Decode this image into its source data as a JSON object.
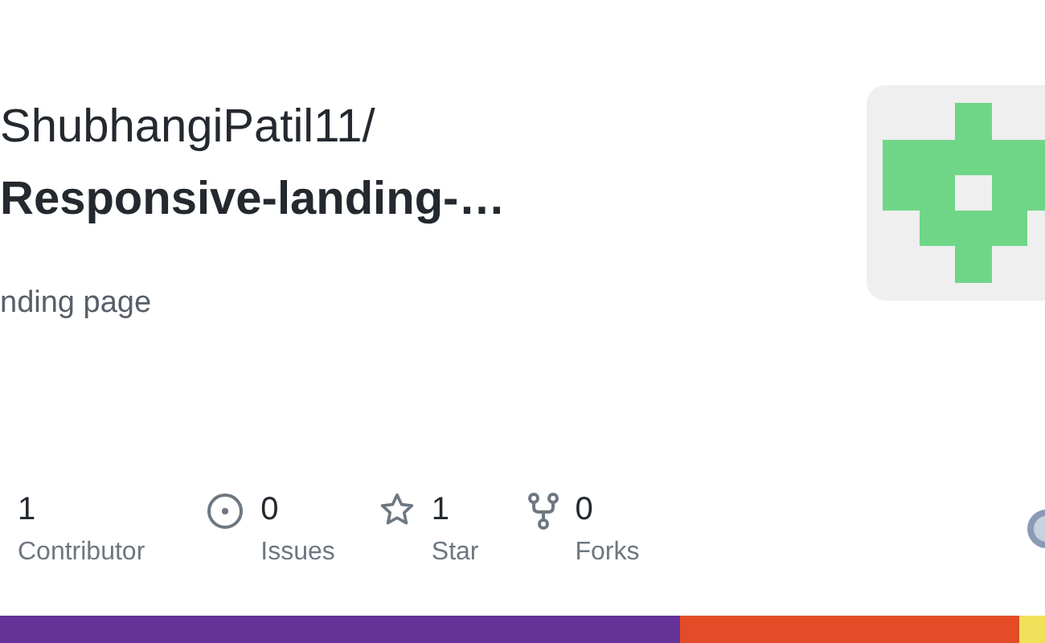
{
  "repo": {
    "owner": "ShubhangiPatil11/",
    "name": "Responsive-landing-…",
    "description": "nding page"
  },
  "stats": [
    {
      "kind": "plain",
      "count": "1",
      "label": "Contributor"
    },
    {
      "kind": "issues",
      "count": "0",
      "label": "Issues"
    },
    {
      "kind": "star",
      "count": "1",
      "label": "Star"
    },
    {
      "kind": "fork",
      "count": "0",
      "label": "Forks"
    }
  ],
  "languages": [
    {
      "color": "#663399"
    },
    {
      "color": "#e34c26"
    },
    {
      "color": "#f1e05a"
    }
  ]
}
